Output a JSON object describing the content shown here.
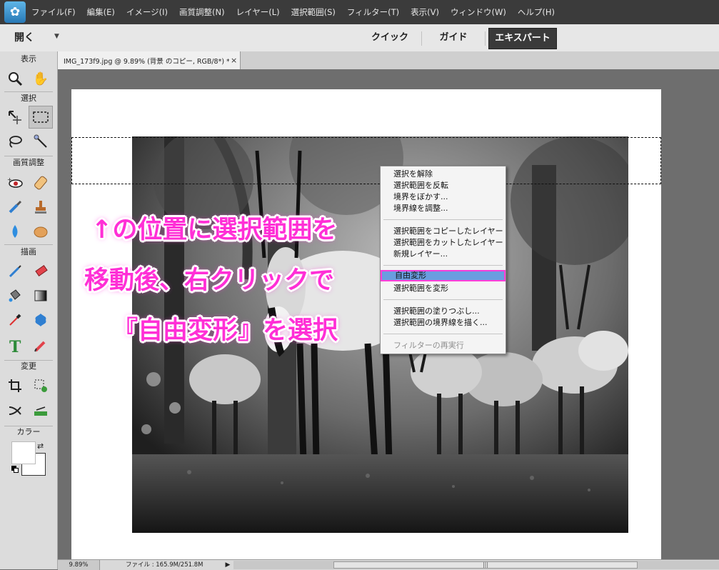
{
  "menubar": {
    "items": [
      "ファイル(F)",
      "編集(E)",
      "イメージ(I)",
      "画質調整(N)",
      "レイヤー(L)",
      "選択範囲(S)",
      "フィルター(T)",
      "表示(V)",
      "ウィンドウ(W)",
      "ヘルプ(H)"
    ]
  },
  "modebar": {
    "open_label": "開く",
    "tabs": [
      "クイック",
      "ガイド",
      "エキスパート"
    ],
    "active_tab": "エキスパート"
  },
  "toolbox": {
    "sections": [
      "表示",
      "選択",
      "画質調整",
      "描画",
      "変更",
      "カラー"
    ],
    "foreground_color": "#000000",
    "background_color": "#ffffff"
  },
  "document": {
    "tab_title": "IMG_173f9.jpg @ 9.89% (背景 のコピー, RGB/8*) *",
    "close_glyph": "×"
  },
  "annotation": {
    "lines": [
      "↑の位置に選択範囲を",
      "移動後、右クリックで",
      "『自由変形』を選択"
    ],
    "color": "#ff2fd6"
  },
  "context_menu": {
    "groups": [
      [
        "選択を解除",
        "選択範囲を反転",
        "境界をぼかす...",
        "境界線を調整..."
      ],
      [
        "選択範囲をコピーしたレイヤー",
        "選択範囲をカットしたレイヤー",
        "新規レイヤー..."
      ],
      [
        "自由変形",
        "選択範囲を変形"
      ],
      [
        "選択範囲の塗りつぶし...",
        "選択範囲の境界線を描く..."
      ],
      [
        "フィルターの再実行"
      ]
    ],
    "highlighted": "自由変形",
    "disabled": "フィルターの再実行",
    "highlight_color": "#6a9de0"
  },
  "statusbar": {
    "zoom": "9.89%",
    "file_info": "ファイル : 165.9M/251.8M",
    "arrow": "▶"
  }
}
